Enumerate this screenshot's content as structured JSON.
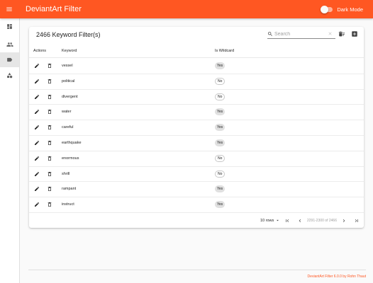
{
  "app": {
    "title": "DeviantArt Filter",
    "dark_mode_label": "Dark Mode",
    "brand_color": "#ff5722"
  },
  "sidebar": {
    "items": [
      {
        "name": "dashboard",
        "icon": "dashboard-icon"
      },
      {
        "name": "users",
        "icon": "people-icon"
      },
      {
        "name": "keywords",
        "icon": "label-icon",
        "active": true
      },
      {
        "name": "categories",
        "icon": "category-icon"
      }
    ]
  },
  "card": {
    "title": "2466 Keyword Filter(s)",
    "search_placeholder": "Search",
    "columns": {
      "actions": "Actions",
      "keyword": "Keyword",
      "wildcard": "Is Wildcard"
    },
    "rows": [
      {
        "keyword": "vessel",
        "wildcard": "Yes"
      },
      {
        "keyword": "political",
        "wildcard": "No"
      },
      {
        "keyword": "divergent",
        "wildcard": "No"
      },
      {
        "keyword": "water",
        "wildcard": "Yes"
      },
      {
        "keyword": "careful",
        "wildcard": "Yes"
      },
      {
        "keyword": "earthquake",
        "wildcard": "Yes"
      },
      {
        "keyword": "enormous",
        "wildcard": "No"
      },
      {
        "keyword": "shrill",
        "wildcard": "No"
      },
      {
        "keyword": "rampant",
        "wildcard": "Yes"
      },
      {
        "keyword": "instruct",
        "wildcard": "Yes"
      }
    ],
    "pagination": {
      "rows_per_page": "10 rows",
      "range": "2291-2300 of 2466"
    }
  },
  "footer": {
    "text": "DeviantArt Filter 6.0.0 by Rohn Thaut"
  }
}
